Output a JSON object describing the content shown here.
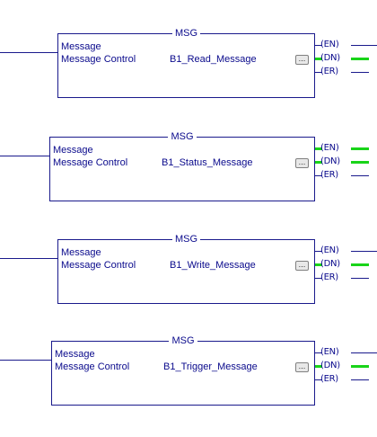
{
  "rungs": [
    {
      "title": "MSG",
      "label1": "Message",
      "label2": "Message Control",
      "tag": "B1_Read_Message",
      "browse": "...",
      "outputs": [
        {
          "label": "EN",
          "active": false
        },
        {
          "label": "DN",
          "active": true
        },
        {
          "label": "ER",
          "active": false
        }
      ]
    },
    {
      "title": "MSG",
      "label1": "Message",
      "label2": "Message Control",
      "tag": "B1_Status_Message",
      "browse": "...",
      "outputs": [
        {
          "label": "EN",
          "active": true
        },
        {
          "label": "DN",
          "active": true
        },
        {
          "label": "ER",
          "active": false
        }
      ]
    },
    {
      "title": "MSG",
      "label1": "Message",
      "label2": "Message Control",
      "tag": "B1_Write_Message",
      "browse": "...",
      "outputs": [
        {
          "label": "EN",
          "active": false
        },
        {
          "label": "DN",
          "active": true
        },
        {
          "label": "ER",
          "active": false
        }
      ]
    },
    {
      "title": "MSG",
      "label1": "Message",
      "label2": "Message Control",
      "tag": "B1_Trigger_Message",
      "browse": "...",
      "outputs": [
        {
          "label": "EN",
          "active": false
        },
        {
          "label": "DN",
          "active": true
        },
        {
          "label": "ER",
          "active": false
        }
      ]
    }
  ],
  "colors": {
    "wire": "#1a1a8c",
    "text": "#0a0a8c",
    "energized": "#19d419"
  }
}
